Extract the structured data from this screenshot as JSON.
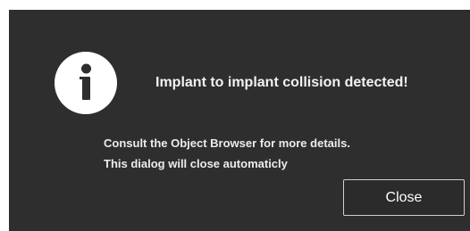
{
  "dialog": {
    "icon": "info-icon",
    "title": "Implant to implant collision detected!",
    "message_lines": [
      "Consult the Object Browser for more details.",
      "This dialog will close automaticly"
    ],
    "close_label": "Close"
  },
  "colors": {
    "dialog_background": "#2e2e2e",
    "text": "#f2f2f2",
    "icon_circle": "#ffffff",
    "button_border": "#cfcfcf"
  }
}
